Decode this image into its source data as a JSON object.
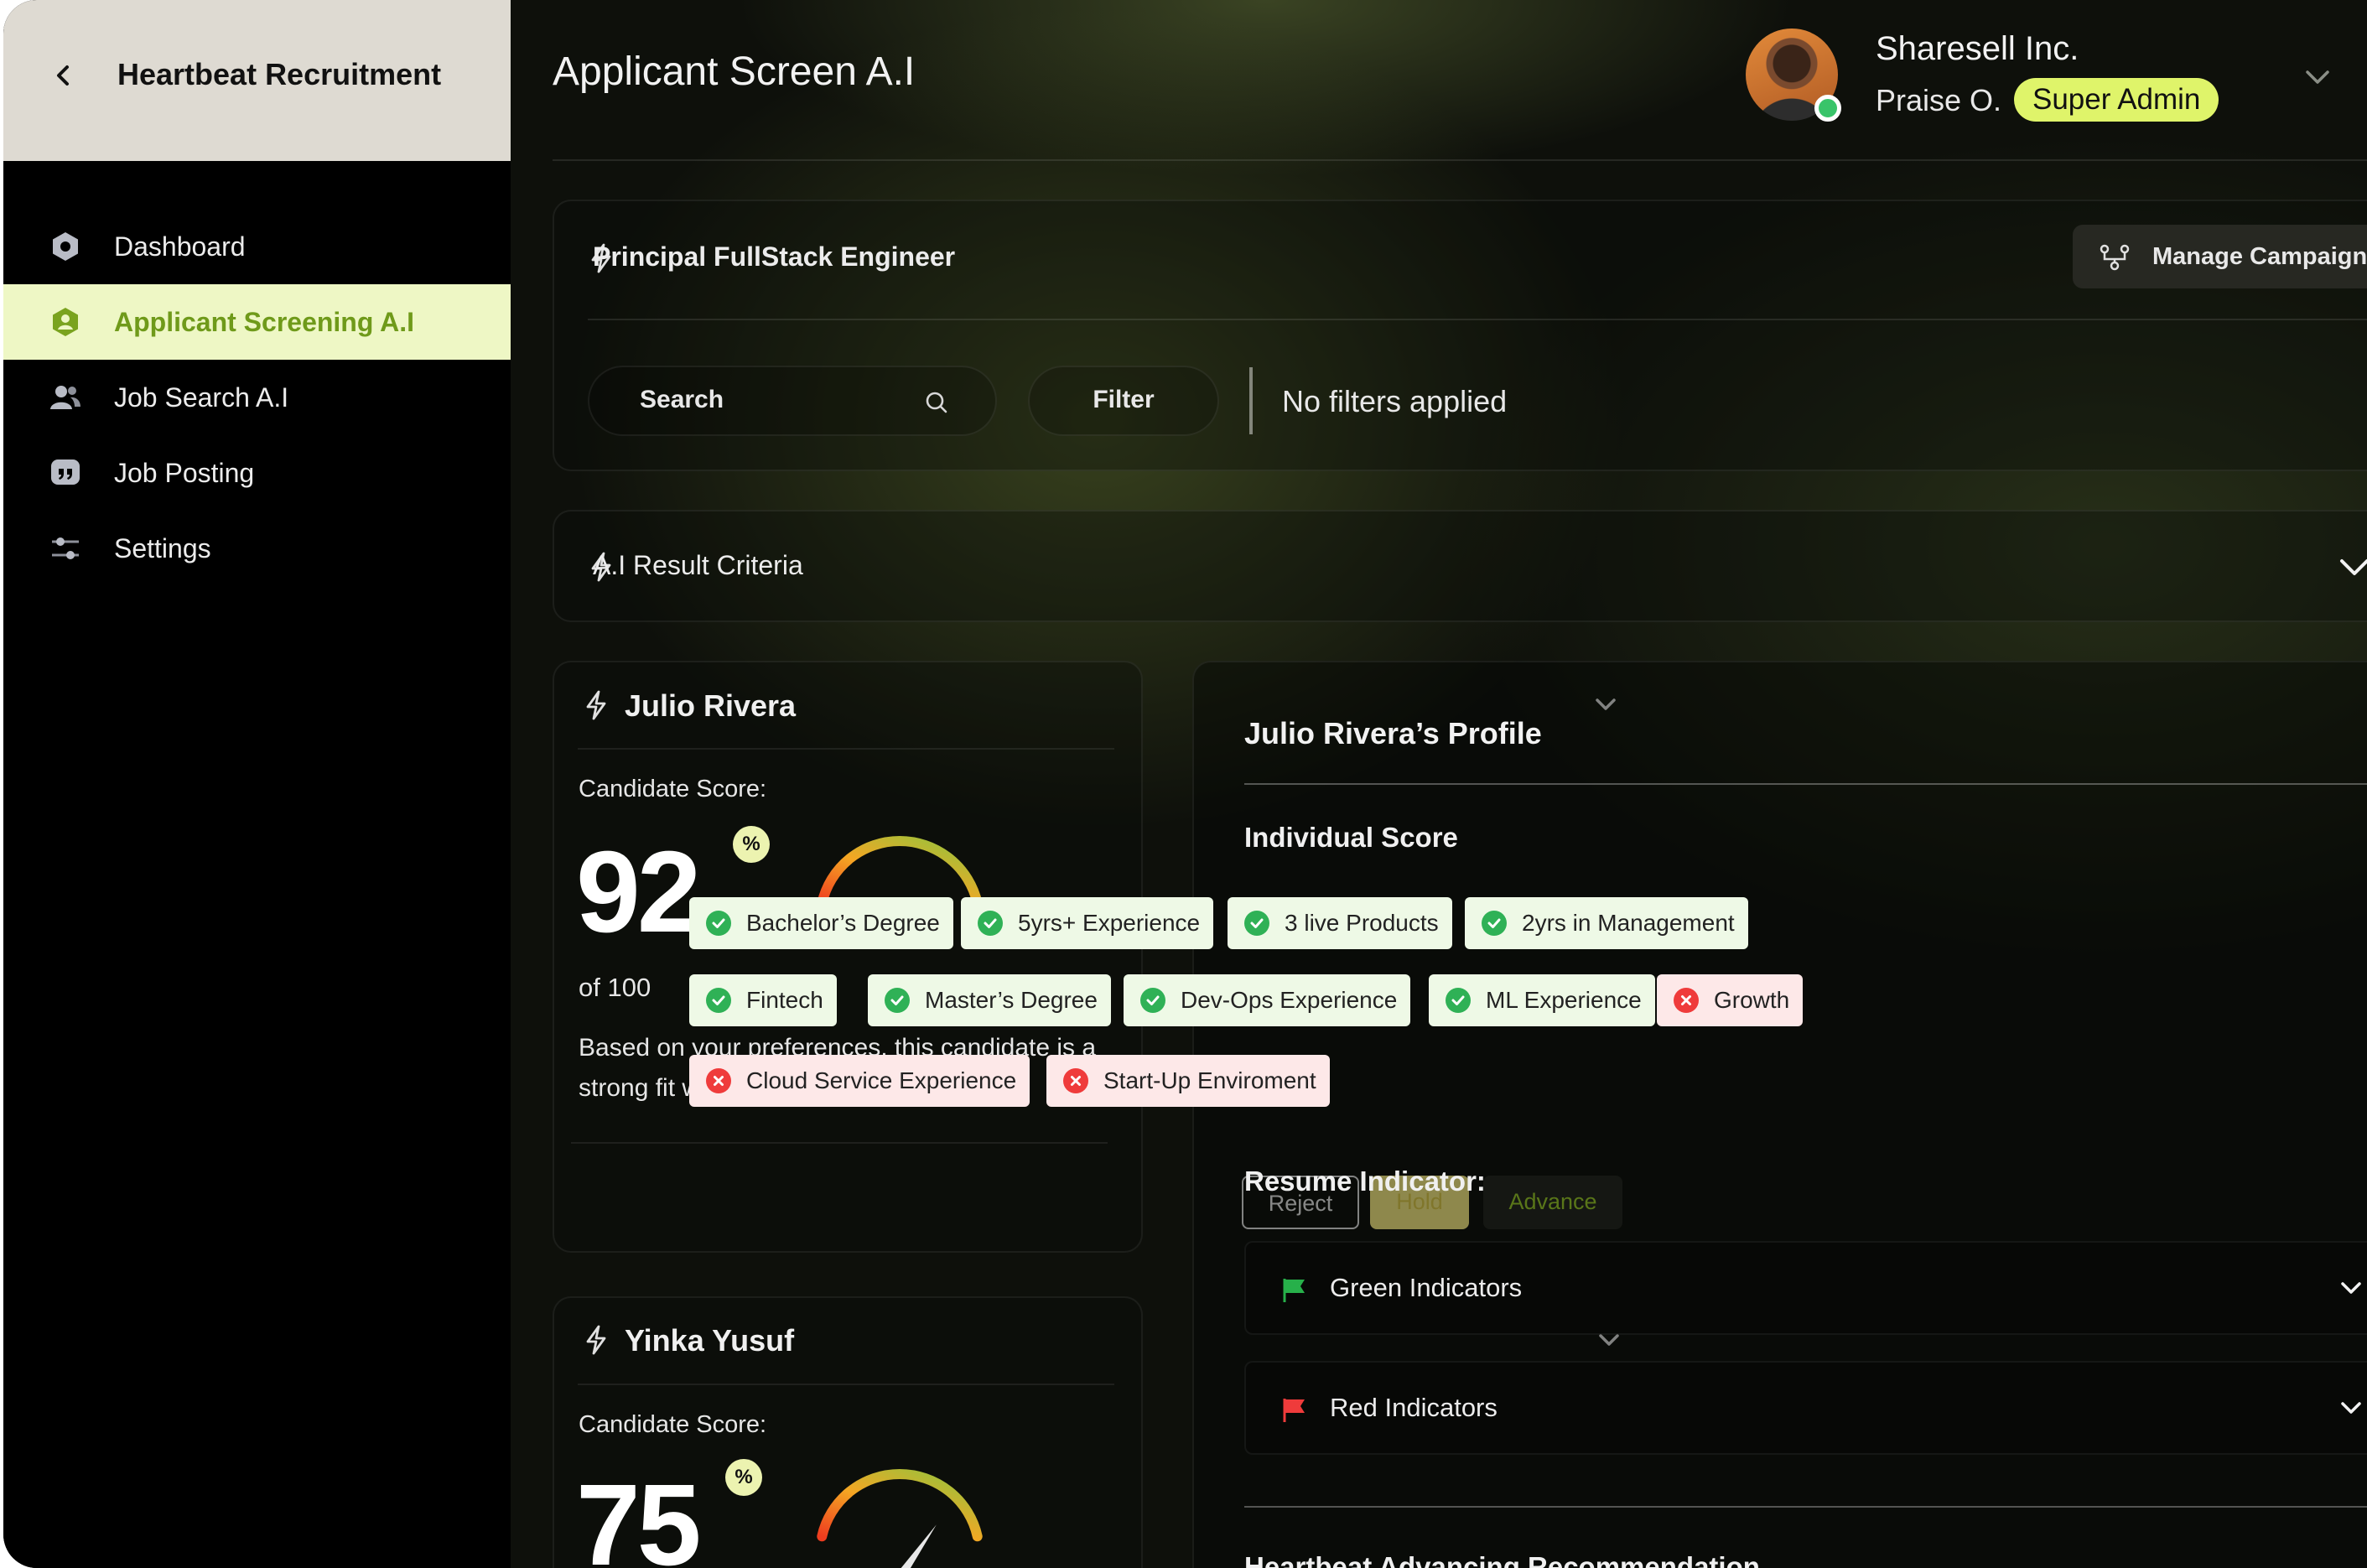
{
  "sidebar": {
    "brand_title": "Heartbeat Recruitment",
    "items": [
      {
        "label": "Dashboard",
        "icon": "hexagon-icon",
        "active": false
      },
      {
        "label": "Applicant Screening A.I",
        "icon": "user-shield-icon",
        "active": true
      },
      {
        "label": "Job Search A.I",
        "icon": "users-icon",
        "active": false
      },
      {
        "label": "Job Posting",
        "icon": "quote-icon",
        "active": false
      },
      {
        "label": "Settings",
        "icon": "sliders-icon",
        "active": false
      }
    ]
  },
  "header": {
    "title": "Applicant Screen A.I",
    "company": "Sharesell Inc.",
    "user_name": "Praise O.",
    "role_badge": "Super Admin"
  },
  "job": {
    "title": "Principal FullStack Engineer",
    "manage_label": "Manage Campaign",
    "search_placeholder": "Search",
    "filter_label": "Filter",
    "filter_status": "No filters applied"
  },
  "criteria": {
    "title": "A.I Result Criteria"
  },
  "candidates": [
    {
      "name": "Julio Rivera",
      "score_label": "Candidate Score:",
      "score": "92",
      "score_value": 92,
      "pct": "%",
      "of_text": "of 100",
      "description": "Based on your preferences, this candidate is a strong fit with a score of 92 out of 100",
      "actions": {
        "reject": "Reject",
        "hold": "Hold",
        "advance": "Advance"
      }
    },
    {
      "name": "Yinka Yusuf",
      "score_label": "Candidate Score:",
      "score": "75",
      "score_value": 75,
      "pct": "%"
    }
  ],
  "profile": {
    "title": "Julio Rivera’s Profile",
    "individual_score_title": "Individual Score",
    "tags": [
      {
        "label": "Bachelor’s Degree",
        "status": "pass"
      },
      {
        "label": "5yrs+ Experience",
        "status": "pass"
      },
      {
        "label": "3 live Products",
        "status": "pass"
      },
      {
        "label": "2yrs in Management",
        "status": "pass"
      },
      {
        "label": "Fintech",
        "status": "pass"
      },
      {
        "label": "Master’s Degree",
        "status": "pass"
      },
      {
        "label": "Dev-Ops Experience",
        "status": "pass"
      },
      {
        "label": "ML Experience",
        "status": "pass"
      },
      {
        "label": "Growth",
        "status": "fail"
      },
      {
        "label": "Cloud Service Experience",
        "status": "fail"
      },
      {
        "label": "Start-Up Enviroment",
        "status": "fail"
      }
    ],
    "resume_indicator_title": "Resume Indicator:",
    "indicators": [
      {
        "label": "Green Indicators",
        "color": "#27b04a"
      },
      {
        "label": "Red Indicators",
        "color": "#ef3b3b"
      }
    ],
    "recommendation_title": "Heartbeat Advancing Recommendation"
  },
  "colors": {
    "accent_lime": "#dff46a",
    "active_nav_bg": "#eef7c5",
    "active_nav_text": "#6f9a1a"
  }
}
